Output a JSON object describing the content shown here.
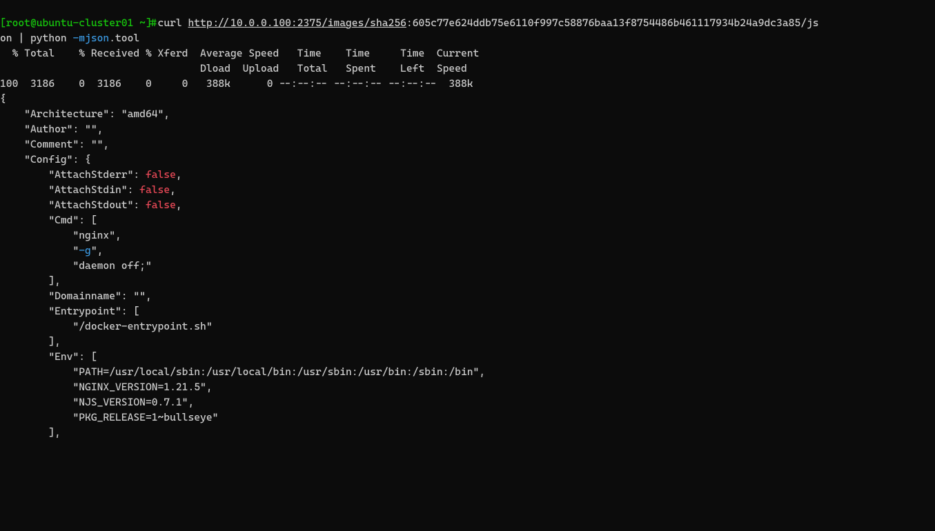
{
  "prompt": {
    "open_bracket": "[",
    "user": "root",
    "at": "@",
    "host": "ubuntu-cluster01",
    "cwd": "~",
    "close_bracket": "]#"
  },
  "command": {
    "curl": "curl ",
    "url": "http://10.0.0.100:2375/images/sha256",
    "url_tail_line1": ":605c77e624ddb75e6110f997c58876baa13f8754486b461117934b24a9dc3a85/js",
    "line2_start": "on | python ",
    "flag": "-mjson",
    "line2_end": ".tool"
  },
  "curl_output": {
    "header1": "  % Total    % Received % Xferd  Average Speed   Time    Time     Time  Current",
    "header2": "                                 Dload  Upload   Total   Spent    Left  Speed",
    "row": "100  3186    0  3186    0     0   388k      0 --:--:-- --:--:-- --:--:--  388k"
  },
  "json": {
    "open": "{",
    "architecture": "    \"Architecture\": \"amd64\",",
    "author": "    \"Author\": \"\",",
    "comment": "    \"Comment\": \"\",",
    "config_open": "    \"Config\": {",
    "attach_stderr_key": "        \"AttachStderr\": ",
    "attach_stdin_key": "        \"AttachStdin\": ",
    "attach_stdout_key": "        \"AttachStdout\": ",
    "false_val": "false",
    "cmd_open": "        \"Cmd\": [",
    "cmd_nginx": "            \"nginx\",",
    "cmd_g_indent": "            \"",
    "cmd_g_flag": "-g",
    "cmd_g_end": "\",",
    "cmd_daemon": "            \"daemon off;\"",
    "cmd_close": "        ],",
    "domainname": "        \"Domainname\": \"\",",
    "entrypoint_open": "        \"Entrypoint\": [",
    "entrypoint_val": "            \"/docker-entrypoint.sh\"",
    "entrypoint_close": "        ],",
    "env_open": "        \"Env\": [",
    "env_path": "            \"PATH=/usr/local/sbin:/usr/local/bin:/usr/sbin:/usr/bin:/sbin:/bin\",",
    "env_nginx": "            \"NGINX_VERSION=1.21.5\",",
    "env_njs": "            \"NJS_VERSION=0.7.1\",",
    "env_pkg": "            \"PKG_RELEASE=1~bullseye\"",
    "env_close": "        ],"
  }
}
